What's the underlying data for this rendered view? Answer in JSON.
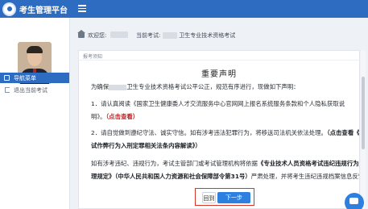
{
  "header": {
    "app_title": "考生管理平台",
    "brand_color": "#2d6cc0"
  },
  "sidebar": {
    "nav_title": "导航菜单",
    "logout_label": "退出当前考试"
  },
  "breadcrumb": {
    "welcome_label": "欢迎您:",
    "current_exam_label": "当前考试:",
    "exam_suffix": "卫生专业技术资格考试"
  },
  "panel": {
    "header": "报考须知",
    "title": "重要声明",
    "intro": "为确保",
    "intro_suffix": "卫生专业技术资格考试公平公正，规范有序进行，现做如下声明：",
    "clause1_text": "1．请认真阅读《国家卫生健康委人才交流服务中心官网网上报名系统服务条款和个人隐私获取说",
    "clause1_tail": "明》。",
    "clause1_link": "（点击查看）",
    "clause2_text": "2．请自觉做到遵纪守法、诚实守信。如有涉考违法犯罪行为，将移送司法机关依法处理。",
    "clause2_link": "（点击查看《考",
    "clause2_tail": "试作弊行为入刑定罪相关法条内容解读》）",
    "clause3_text": "如有涉考违纪、违规行为，考试主管部门或考试管理机构将依据",
    "clause3_strong": "《专业技术人员资格考试违纪违规行为处",
    "clause3_strong2": "理规定》（中华人民共和国人力资源和社会保障部令第31号）",
    "clause3_tail": "严肃处理，并将考生违纪违规档案信息反馈至人"
  },
  "actions": {
    "back_label": "回到",
    "next_label": "下一步"
  },
  "colors": {
    "link_red": "#c21f1f",
    "button_blue": "#2d7fe0",
    "highlight_border": "#d9362b"
  }
}
